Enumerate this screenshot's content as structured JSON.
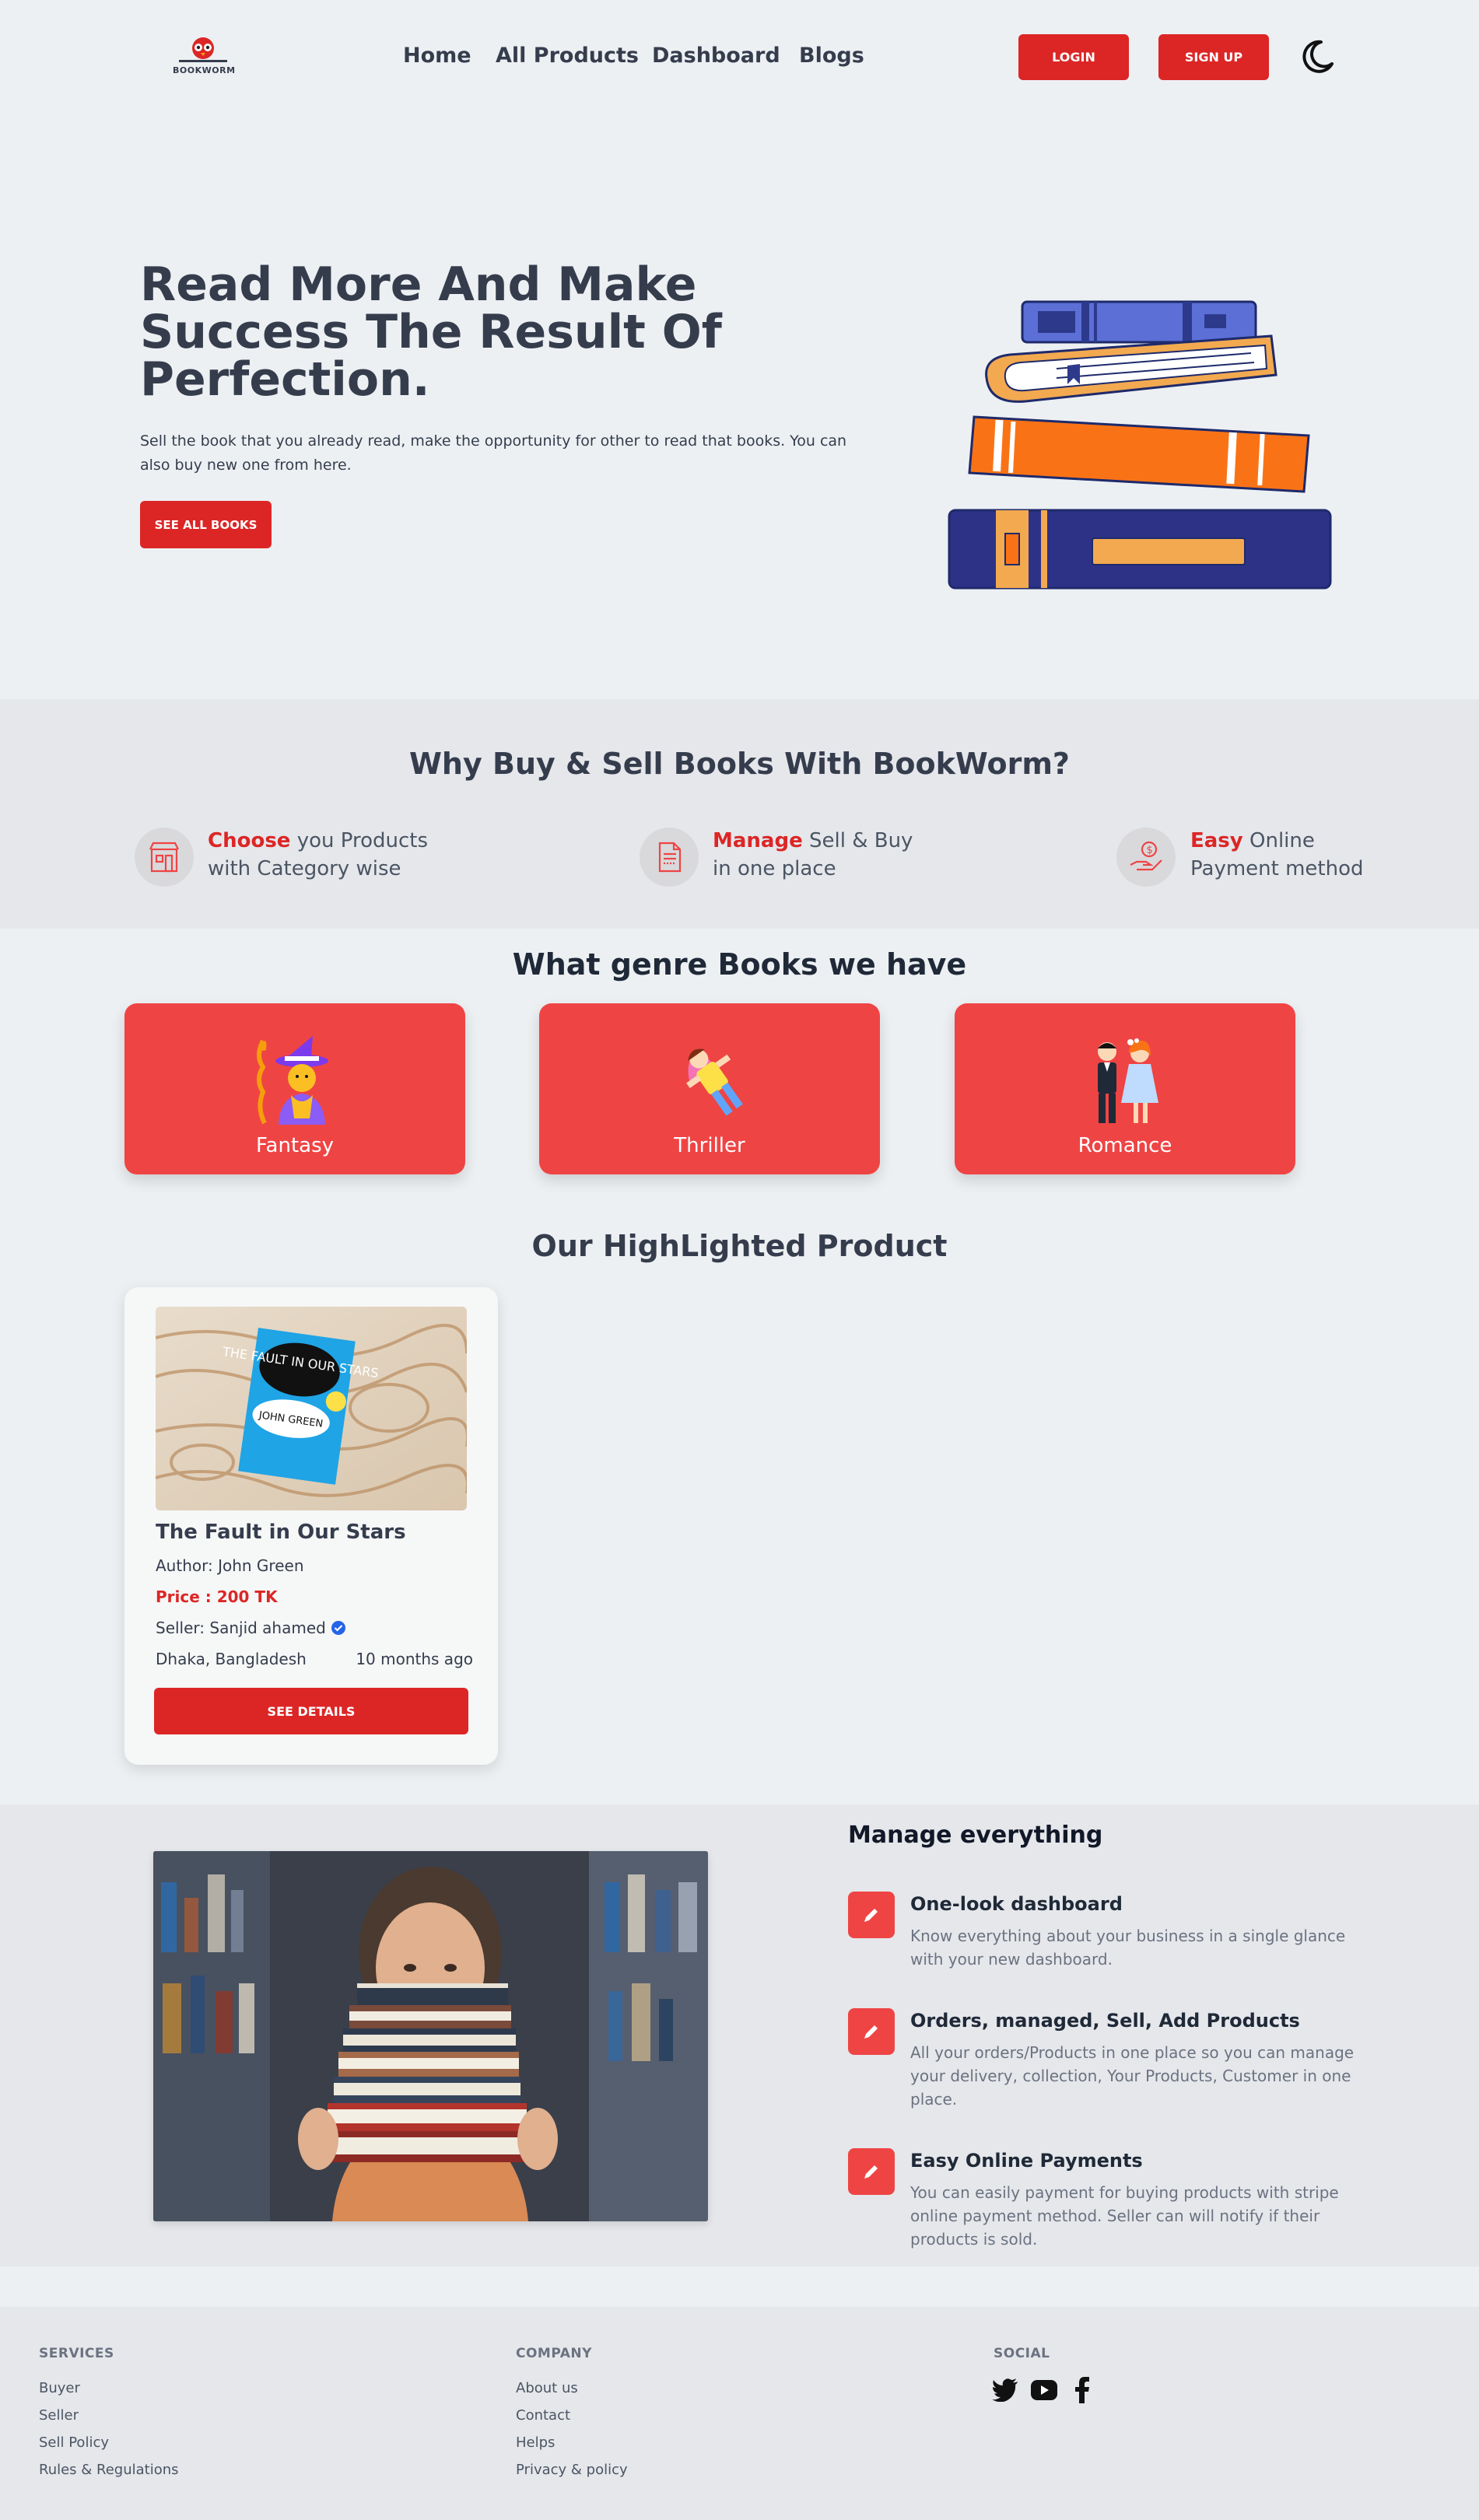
{
  "header": {
    "logo_text": "BOOKWORM",
    "nav": [
      "Home",
      "All Products",
      "Dashboard",
      "Blogs"
    ],
    "login_label": "LOGIN",
    "signup_label": "SIGN UP",
    "theme_icon": "moon-icon"
  },
  "hero": {
    "title": "Read More And Make Success The Result Of Perfection.",
    "subtitle": "Sell the book that you already read, make the opportunity for other to read that books. You can also buy new one from here.",
    "cta_label": "SEE ALL BOOKS",
    "illustration": "stacked-books"
  },
  "why": {
    "title": "Why Buy & Sell Books With BookWorm?",
    "items": [
      {
        "highlight": "Choose",
        "rest1": " you Products",
        "rest2": "with Category wise",
        "icon": "store-icon"
      },
      {
        "highlight": "Manage",
        "rest1": " Sell & Buy",
        "rest2": "in one place",
        "icon": "document-icon"
      },
      {
        "highlight": "Easy",
        "rest1": " Online",
        "rest2": "Payment method",
        "icon": "payment-hand-icon"
      }
    ]
  },
  "genres": {
    "title": "What genre Books we have",
    "items": [
      {
        "label": "Fantasy",
        "icon": "wizard-icon"
      },
      {
        "label": "Thriller",
        "icon": "superhero-icon"
      },
      {
        "label": "Romance",
        "icon": "couple-icon"
      }
    ]
  },
  "highlighted": {
    "title": "Our HighLighted Product",
    "product": {
      "name": "The Fault in Our Stars",
      "author": "Author: John Green",
      "price": "Price : 200 TK",
      "seller": "Seller: Sanjid ahamed",
      "location": "Dhaka, Bangladesh",
      "posted": "10 months ago",
      "button": "SEE DETAILS",
      "cover_title": "THE FAULT IN OUR STARS",
      "cover_author": "JOHN GREEN"
    }
  },
  "manage": {
    "title": "Manage everything",
    "features": [
      {
        "title": "One-look dashboard",
        "desc": "Know everything about your business in a single glance with your new dashboard."
      },
      {
        "title": "Orders, managed, Sell, Add Products",
        "desc": "All your orders/Products in one place so you can manage your delivery, collection, Your Products, Customer in one place."
      },
      {
        "title": "Easy Online Payments",
        "desc": "You can easily payment for buying products with stripe online payment method. Seller can will notify if their products is sold."
      }
    ]
  },
  "footer": {
    "services": {
      "title": "SERVICES",
      "links": [
        "Buyer",
        "Seller",
        "Sell Policy",
        "Rules & Regulations"
      ]
    },
    "company": {
      "title": "COMPANY",
      "links": [
        "About us",
        "Contact",
        "Helps",
        "Privacy & policy"
      ]
    },
    "social": {
      "title": "SOCIAL",
      "icons": [
        "twitter-icon",
        "youtube-icon",
        "facebook-icon"
      ]
    }
  },
  "colors": {
    "accent": "#dc2626",
    "card_red": "#ef4444",
    "text": "#353d4d",
    "bg": "#edf0f3"
  }
}
